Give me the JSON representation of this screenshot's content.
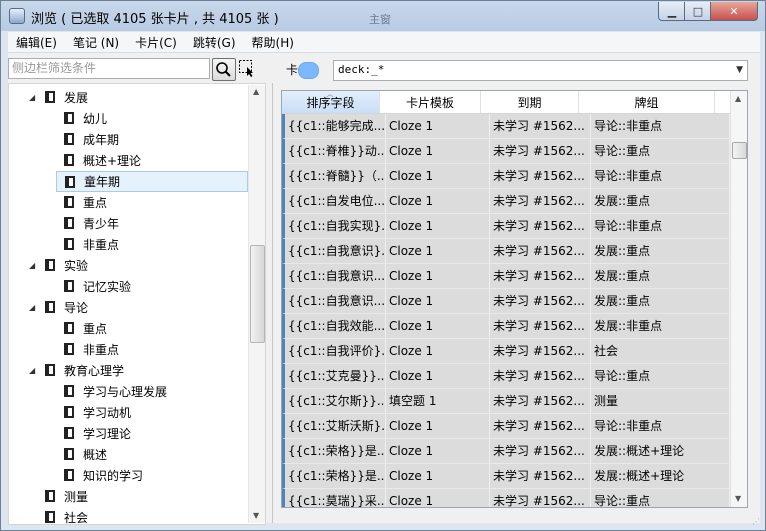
{
  "window": {
    "title": "浏览 ( 已选取 4105 张卡片 , 共 4105 张 )",
    "center_caption": "主窗",
    "min_glyph": "▁",
    "max_glyph": "□",
    "close_glyph": "✕"
  },
  "menu": [
    "编辑(E)",
    "笔记 (N)",
    "卡片(C)",
    "跳转(G)",
    "帮助(H)"
  ],
  "sidebar": {
    "search_placeholder": "侧边栏筛选条件",
    "tree": [
      {
        "label": "发展",
        "level": 1,
        "expanded": true
      },
      {
        "label": "幼儿",
        "level": 2
      },
      {
        "label": "成年期",
        "level": 2
      },
      {
        "label": "概述+理论",
        "level": 2
      },
      {
        "label": "童年期",
        "level": 2,
        "selected": true
      },
      {
        "label": "重点",
        "level": 2
      },
      {
        "label": "青少年",
        "level": 2
      },
      {
        "label": "非重点",
        "level": 2
      },
      {
        "label": "实验",
        "level": 1,
        "expanded": true
      },
      {
        "label": "记忆实验",
        "level": 2
      },
      {
        "label": "导论",
        "level": 1,
        "expanded": true
      },
      {
        "label": "重点",
        "level": 2
      },
      {
        "label": "非重点",
        "level": 2
      },
      {
        "label": "教育心理学",
        "level": 1,
        "expanded": true
      },
      {
        "label": "学习与心理发展",
        "level": 2
      },
      {
        "label": "学习动机",
        "level": 2
      },
      {
        "label": "学习理论",
        "level": 2
      },
      {
        "label": "概述",
        "level": 2
      },
      {
        "label": "知识的学习",
        "level": 2
      },
      {
        "label": "测量",
        "level": 1
      },
      {
        "label": "社会",
        "level": 1
      }
    ]
  },
  "main": {
    "toggle_label": "卡",
    "search_value": "deck:_*",
    "columns": [
      "排序字段",
      "卡片模板",
      "到期",
      "牌组"
    ],
    "rows": [
      [
        "{{c1::能够完成...",
        "Cloze 1",
        "未学习 #1562...",
        "导论::非重点"
      ],
      [
        "{{c1::脊椎}}动...",
        "Cloze 1",
        "未学习 #1562...",
        "导论::重点"
      ],
      [
        "{{c1::脊髓}}（...",
        "Cloze 1",
        "未学习 #1562...",
        "导论::非重点"
      ],
      [
        "{{c1::自发电位...",
        "Cloze 1",
        "未学习 #1562...",
        "发展::重点"
      ],
      [
        "{{c1::自我实现}...",
        "Cloze 1",
        "未学习 #1562...",
        "导论::非重点"
      ],
      [
        "{{c1::自我意识}...",
        "Cloze 1",
        "未学习 #1562...",
        "发展::重点"
      ],
      [
        "{{c1::自我意识...",
        "Cloze 1",
        "未学习 #1562...",
        "发展::重点"
      ],
      [
        "{{c1::自我意识...",
        "Cloze 1",
        "未学习 #1562...",
        "发展::重点"
      ],
      [
        "{{c1::自我效能...",
        "Cloze 1",
        "未学习 #1562...",
        "发展::非重点"
      ],
      [
        "{{c1::自我评价}...",
        "Cloze 1",
        "未学习 #1562...",
        "社会"
      ],
      [
        "{{c1::艾克曼}}...",
        "Cloze 1",
        "未学习 #1562...",
        "导论::重点"
      ],
      [
        "{{c1::艾尔斯}}...",
        "填空题 1",
        "未学习 #1562...",
        "测量"
      ],
      [
        "{{c1::艾斯沃斯}...",
        "Cloze 1",
        "未学习 #1562...",
        "导论::非重点"
      ],
      [
        "{{c1::荣格}}是...",
        "Cloze 1",
        "未学习 #1562...",
        "发展::概述+理论"
      ],
      [
        "{{c1::荣格}}是...",
        "Cloze 1",
        "未学习 #1562...",
        "发展::概述+理论"
      ],
      [
        "{{c1::莫瑞}}采...",
        "Cloze 1",
        "未学习 #1562...",
        "导论::重点"
      ]
    ]
  }
}
